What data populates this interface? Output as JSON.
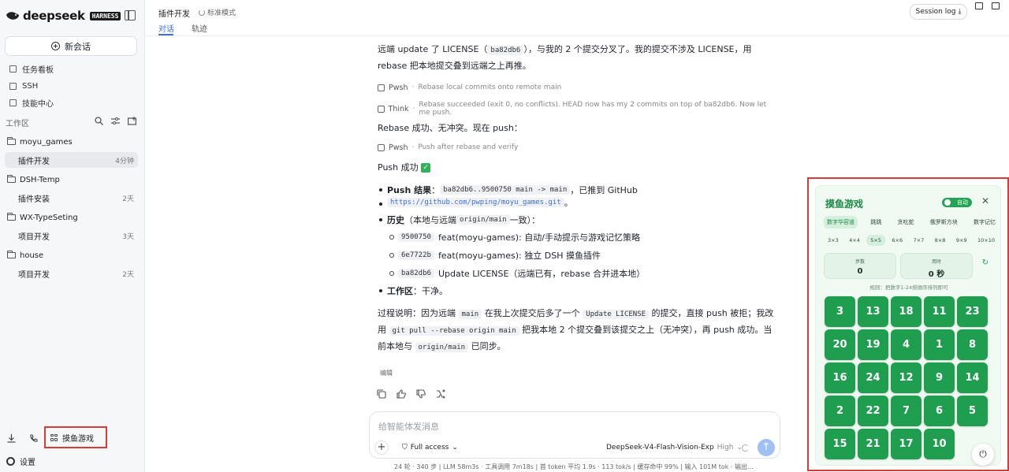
{
  "app": {
    "logo_text": "deepseek",
    "logo_badge": "HARNESS"
  },
  "sidebar": {
    "new_chat": "新会话",
    "nav": [
      {
        "label": "任务看板",
        "icon": "board-icon"
      },
      {
        "label": "SSH",
        "icon": "terminal-icon"
      },
      {
        "label": "技能中心",
        "icon": "book-icon"
      }
    ],
    "workspace_label": "工作区",
    "projects": [
      {
        "name": "moyu_games",
        "sessions": [
          {
            "label": "插件开发",
            "time": "4分钟",
            "active": true
          }
        ]
      },
      {
        "name": "DSH-Temp",
        "sessions": [
          {
            "label": "插件安装",
            "time": "2天"
          }
        ]
      },
      {
        "name": "WX-TypeSeting",
        "sessions": [
          {
            "label": "项目开发",
            "time": "3天"
          }
        ]
      },
      {
        "name": "house",
        "sessions": [
          {
            "label": "项目开发",
            "time": "2天"
          }
        ]
      }
    ],
    "game_button": "摸鱼游戏",
    "settings": "设置"
  },
  "header": {
    "title": "插件开发",
    "mode": "标准模式",
    "tabs": [
      {
        "label": "对话",
        "active": true
      },
      {
        "label": "轨迹"
      }
    ],
    "session_log": "Session log"
  },
  "chat": {
    "p1a": "远端 update 了 LICENSE（",
    "p1code": "ba82db6",
    "p1b": "），与我的 2 个提交分叉了。我的提交不涉及 LICENSE，用 rebase 把本地提交叠到远端之上再推。",
    "tool1": {
      "name": "Pwsh",
      "desc": "Rebase local commits onto remote main"
    },
    "tool2": {
      "name": "Think",
      "desc": "Rebase succeeded (exit 0, no conflicts). HEAD now has my 2 commits on top of ba82db6. Now let me push."
    },
    "p2": "Rebase 成功、无冲突。现在 push：",
    "tool3": {
      "name": "Pwsh",
      "desc": "Push after rebase and verify"
    },
    "p3": "Push 成功",
    "b1_label": "Push 结果",
    "b1_code": "ba82db6..9500750 main -> main",
    "b1_text": "，已推到 GitHub",
    "b1_url": "https://github.com/pwping/moyu_games.git",
    "b2_label": "历史",
    "b2_text_a": "（本地与远端",
    "b2_code": "origin/main",
    "b2_text_b": "一致）：",
    "commits": [
      {
        "hash": "9500750",
        "msg": "feat(moyu-games): 自动/手动提示与游戏记忆策略"
      },
      {
        "hash": "6e7722b",
        "msg": "feat(moyu-games): 独立 DSH 摸鱼插件"
      },
      {
        "hash": "ba82db6",
        "msg": "Update LICENSE（远端已有，rebase 合并进本地）"
      }
    ],
    "b3_label": "工作区",
    "b3_text": "：干净。",
    "p4a": "过程说明：因为远端",
    "p4c1": "main",
    "p4b": "在我上次提交后多了一个",
    "p4c2": "Update LICENSE",
    "p4c": "的提交，直接 push 被拒；我改用",
    "p4c3": "git pull --rebase origin main",
    "p4d": "把我本地 2 个提交叠到该提交之上（无冲突），再 push 成功。当前本地与",
    "p4c4": "origin/main",
    "p4e": "已同步。",
    "edit_tag": "编辑"
  },
  "input": {
    "placeholder": "给智能体发消息",
    "access": "Full access",
    "model": "DeepSeek-V4-Flash-Vision-Exp",
    "effort": "High"
  },
  "stats": "24 轮 · 340 步  |  LLM 58m3s · 工具调用 7m18s  |  首 token 平均 1.9s · 113 tok/s  |  缓存命中 99%  |  输入 101M tok · 输出...",
  "game": {
    "title": "摸鱼游戏",
    "auto_label": "自动",
    "tabs": [
      "数字华容道",
      "跳跳",
      "贪吃蛇",
      "俄罗斯方块",
      "数字记忆"
    ],
    "sizes": [
      "3×3",
      "4×4",
      "5×5",
      "6×6",
      "7×7",
      "8×8",
      "9×9",
      "10×10"
    ],
    "active_size": "5×5",
    "steps_label": "步数",
    "steps_value": "0",
    "time_label": "用时",
    "time_value": "0 秒",
    "hint": "规则：把数字1-24按顺序排列即可",
    "tiles": [
      [
        3,
        13,
        18,
        11,
        23
      ],
      [
        20,
        19,
        4,
        1,
        8
      ],
      [
        16,
        24,
        12,
        9,
        14
      ],
      [
        2,
        22,
        7,
        6,
        5
      ],
      [
        15,
        21,
        17,
        10,
        null
      ]
    ]
  }
}
